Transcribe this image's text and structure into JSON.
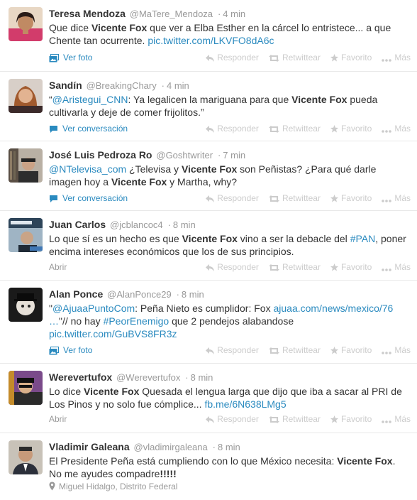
{
  "actions": {
    "reply": "Responder",
    "retweet": "Retwittear",
    "favorite": "Favorito",
    "more": "Más"
  },
  "colors": {
    "link": "#2a8abf",
    "muted": "#999999",
    "action": "#cccccc",
    "text": "#333333"
  },
  "tweets": [
    {
      "name": "Teresa Mendoza",
      "username": "@MaTere_Mendoza",
      "time": "4 min",
      "parts": [
        {
          "t": "Que dice "
        },
        {
          "t": "Vicente Fox",
          "b": true
        },
        {
          "t": " que ver a Elba Esther en la cárcel lo entristece... a que Chente tan ocurrente. "
        },
        {
          "t": "pic.twitter.com/LKVFO8dA6c",
          "a": true
        }
      ],
      "expand": "Ver foto",
      "expand_icon": "photo-icon"
    },
    {
      "name": "Sandín",
      "username": "@BreakingChary",
      "time": "4 min",
      "parts": [
        {
          "t": "“"
        },
        {
          "t": "@Aristegui_CNN",
          "a": true
        },
        {
          "t": ": Ya legalicen la mariguana para que "
        },
        {
          "t": "Vicente Fox",
          "b": true
        },
        {
          "t": " pueda cultivarla y deje de comer frijolitos.”"
        }
      ],
      "expand": "Ver conversación",
      "expand_icon": "conversation-icon"
    },
    {
      "name": "José Luis Pedroza Ro",
      "username": "@Goshtwriter",
      "time": "7 min",
      "parts": [
        {
          "t": "@NTelevisa_com",
          "a": true
        },
        {
          "t": " ¿Televisa y "
        },
        {
          "t": "Vicente Fox",
          "b": true
        },
        {
          "t": " son Peñistas? ¿Para qué darle imagen hoy a "
        },
        {
          "t": "Vicente Fox",
          "b": true
        },
        {
          "t": " y Martha, why?"
        }
      ],
      "expand": "Ver conversación",
      "expand_icon": "conversation-icon"
    },
    {
      "name": "Juan Carlos",
      "username": "@jcblancoc4",
      "time": "8 min",
      "parts": [
        {
          "t": "Lo que sí es un hecho es que "
        },
        {
          "t": "Vicente Fox",
          "b": true
        },
        {
          "t": " vino a ser la debacle del "
        },
        {
          "t": "#PAN",
          "a": true
        },
        {
          "t": ", poner encima intereses económicos que los de sus principios."
        }
      ],
      "expand": "Abrir",
      "expand_icon": ""
    },
    {
      "name": "Alan Ponce",
      "username": "@AlanPonce29",
      "time": "8 min",
      "parts": [
        {
          "t": "\""
        },
        {
          "t": "@AjuaaPuntoCom",
          "a": true
        },
        {
          "t": ": Peña Nieto es cumplidor: Fox "
        },
        {
          "t": "ajuaa.com/news/mexico/76 …",
          "a": true
        },
        {
          "t": "\"// no hay "
        },
        {
          "t": "#PeorEnemigo",
          "a": true
        },
        {
          "t": " que 2 pendejos alabandose "
        },
        {
          "t": "pic.twitter.com/GuBVS8FR3z",
          "a": true
        }
      ],
      "expand": "Ver foto",
      "expand_icon": "photo-icon"
    },
    {
      "name": "Werevertufox",
      "username": "@Werevertufox",
      "time": "8 min",
      "parts": [
        {
          "t": "Lo dice "
        },
        {
          "t": "Vicente Fox",
          "b": true
        },
        {
          "t": " Quesada el lengua larga que dijo que iba a sacar al PRI de Los Pinos y no solo fue cómplice... "
        },
        {
          "t": "fb.me/6N638LMg5",
          "a": true
        }
      ],
      "expand": "Abrir",
      "expand_icon": ""
    },
    {
      "name": "Vladimir Galeana",
      "username": "@vladimirgaleana",
      "time": "8 min",
      "parts": [
        {
          "t": "El Presidente Peña está cumpliendo con lo que México necesita: "
        },
        {
          "t": "Vicente Fox",
          "b": true
        },
        {
          "t": ". No me ayudes compadre"
        },
        {
          "t": "!!!!!",
          "b": true
        }
      ],
      "location": "Miguel Hidalgo, Distrito Federal"
    }
  ]
}
